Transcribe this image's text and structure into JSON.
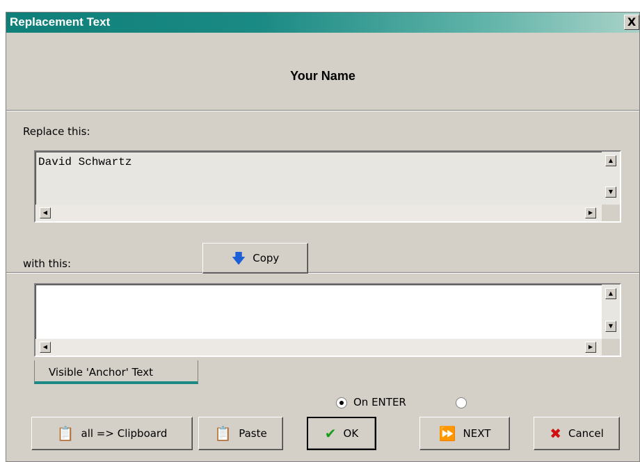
{
  "window": {
    "title": "Replacement Text",
    "close_label": "X"
  },
  "header": {
    "title": "Your Name"
  },
  "source": {
    "label": "Replace this:",
    "value": "David Schwartz"
  },
  "target": {
    "label": "with this:",
    "value": ""
  },
  "copy_button": {
    "label": "Copy",
    "icon": "arrow-down-icon"
  },
  "tab": {
    "label": "Visible 'Anchor' Text"
  },
  "radio": {
    "option1_label": "On ENTER",
    "option1_selected": true,
    "option2_selected": false
  },
  "buttons": {
    "clipboard_label": "all => Clipboard",
    "paste_label": "Paste",
    "ok_label": "OK",
    "next_label": "NEXT",
    "cancel_label": "Cancel"
  },
  "colors": {
    "title_start": "#0f7f7a",
    "title_end": "#a9d2c8",
    "face": "#d4d0c8",
    "ok_check": "#1a9a1a",
    "cancel_x": "#d01010",
    "next_arrows": "#1c5fd6"
  }
}
